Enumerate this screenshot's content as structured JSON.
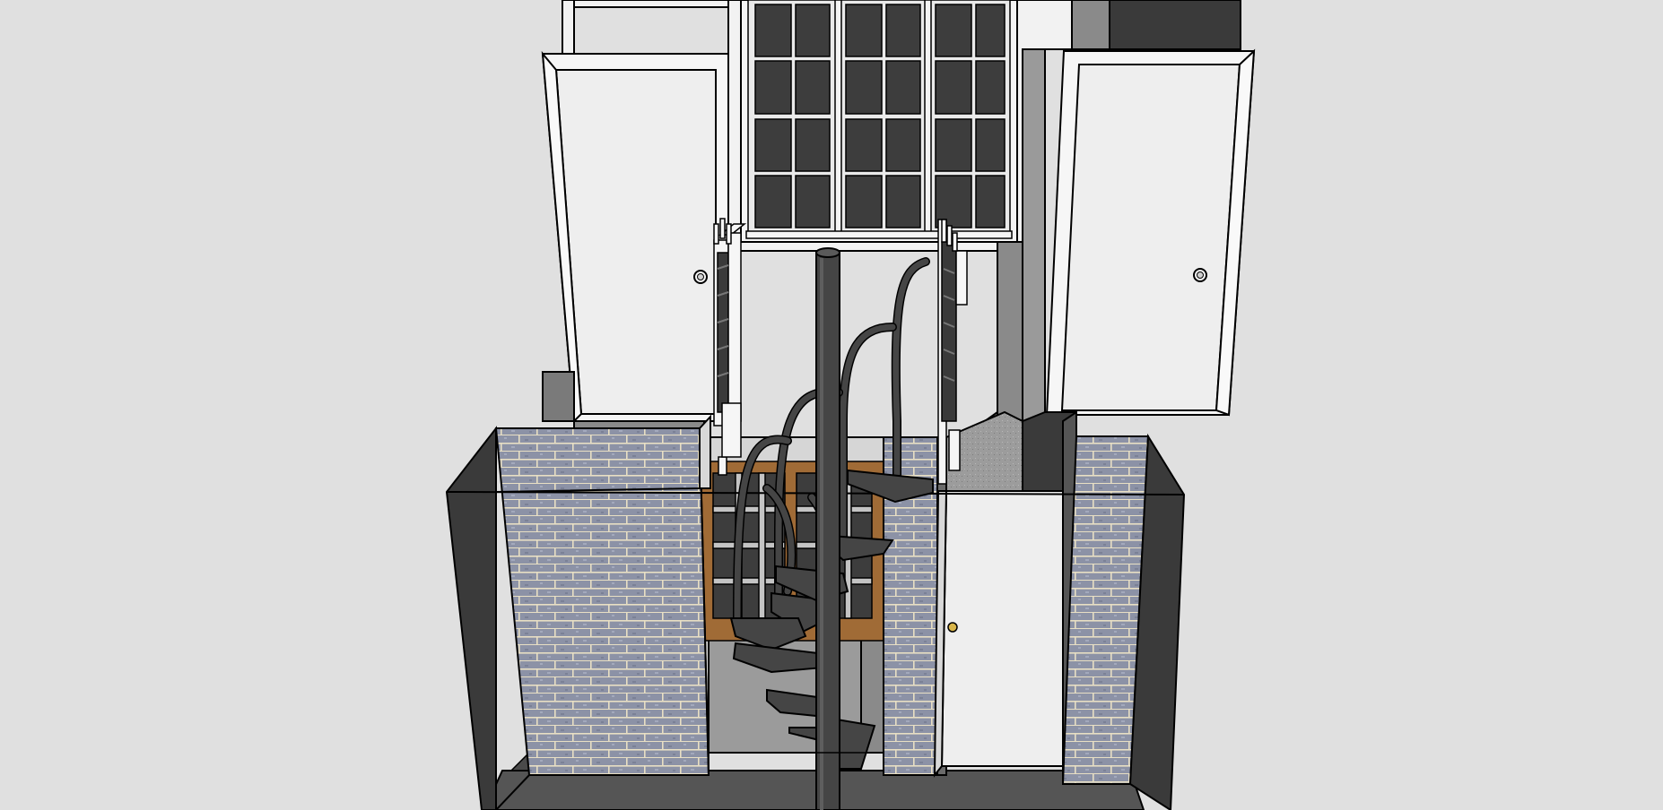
{
  "viewport": {
    "background": "#e0e0e0"
  },
  "palette": {
    "outline": "#000000",
    "wall_white": "#f2f2f2",
    "door_face": "#eeeeee",
    "shadow_grey": "#9a9a9a",
    "mid_grey": "#7a7a7a",
    "dark_grey": "#3a3a3a",
    "steel": "#454545",
    "brick_face": "#8e94a8",
    "mortar": "#e8dfc4",
    "wood_frame": "#9c6a34",
    "floor": "#555555",
    "knob_brass": "#d9b64a"
  },
  "model": {
    "objects": [
      "upper-left-door",
      "upper-right-door",
      "upper-window",
      "spiral-stair",
      "left-brick-pier",
      "center-brick-pier",
      "right-brick-pier",
      "lower-door",
      "lower-window",
      "left-railing",
      "right-railing"
    ]
  }
}
